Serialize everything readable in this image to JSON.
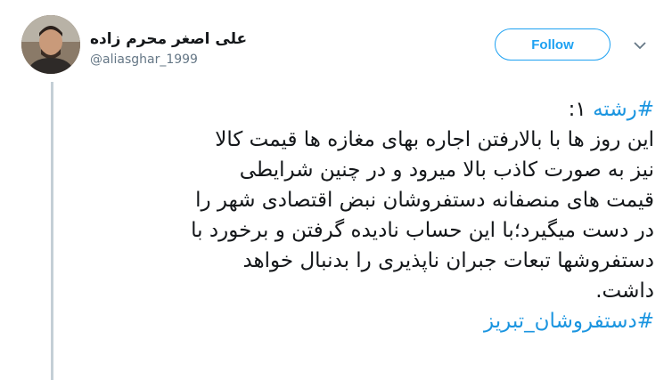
{
  "user": {
    "display_name": "علی اصغر محرم زاده",
    "handle": "@aliasghar_1999"
  },
  "follow_label": "Follow",
  "tweet": {
    "hashtag_thread": "#رشته",
    "thread_number": " ۱:",
    "lines": [
      "این روز ها با بالارفتن اجاره بهای مغازه ها قیمت کالا",
      "نیز به صورت کاذب بالا میرود و در چنین شرایطی",
      "قیمت های منصفانه دستفروشان نبض اقتصادی شهر را",
      "در دست میگیرد؛با این حساب نادیده گرفتن و برخورد با",
      "دستفروشها تبعات جبران ناپذیری را بدنبال خواهد",
      "داشت."
    ],
    "hashtag_end": "#دستفروشان_تبریز"
  },
  "colors": {
    "accent": "#1da1f2",
    "hashtag": "#1b95e0",
    "thread_line": "#c4cfd6"
  }
}
